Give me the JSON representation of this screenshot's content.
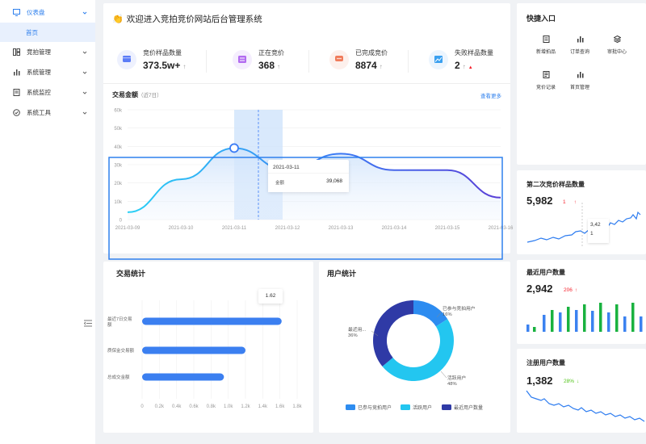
{
  "sidebar": {
    "items": [
      {
        "label": "仪表盘",
        "icon": "monitor-icon",
        "active": true
      },
      {
        "label": "竞拍管理",
        "icon": "layout-icon"
      },
      {
        "label": "系统管理",
        "icon": "bar-chart-icon"
      },
      {
        "label": "系统监控",
        "icon": "document-icon"
      },
      {
        "label": "系统工具",
        "icon": "check-circle-icon"
      }
    ],
    "sub_item": "首页",
    "collapse_icon": "menu-fold-icon"
  },
  "header": {
    "title": "欢迎进入竞拍竞价网站后台管理系统",
    "emoji": "👏"
  },
  "stats": [
    {
      "label": "竞价样品数量",
      "value": "373.5w+",
      "trend": "↑",
      "color": "#5b7cf7",
      "bg": "#eef1fe"
    },
    {
      "label": "正在竞价",
      "value": "368",
      "trend": "↑",
      "color": "#b26bf0",
      "bg": "#f5eefe"
    },
    {
      "label": "已完成竞价",
      "value": "8874",
      "trend": "↑",
      "color": "#f07b5a",
      "bg": "#fdf0ec"
    },
    {
      "label": "失败样品数量",
      "value": "2",
      "trend": "↑",
      "trend2": "▲",
      "color": "#3aa0f0",
      "bg": "#ecf5fe"
    }
  ],
  "trade_amount": {
    "title": "交易金额",
    "subtitle": "（近7日）",
    "more": "查看更多",
    "tooltip": {
      "date": "2021-03-11",
      "label": "金额",
      "value": "39,068"
    }
  },
  "chart_data": [
    {
      "type": "area",
      "title": "交易金额",
      "x": [
        "2021-03-09",
        "2021-03-10",
        "2021-03-11",
        "2021-03-12",
        "2021-03-13",
        "2021-03-14",
        "2021-03-15",
        "2021-03-16"
      ],
      "values": [
        4000,
        22000,
        39068,
        27000,
        36000,
        27000,
        27000,
        12000
      ],
      "yticks": [
        "0",
        "10k",
        "20k",
        "30k",
        "40k",
        "50k",
        "60k"
      ],
      "ylim": [
        0,
        60000
      ]
    },
    {
      "type": "bar",
      "title": "交易统计",
      "categories": [
        "最近7日交易额",
        "质保金交易额",
        "总成交金额"
      ],
      "values": [
        1.62,
        1.2,
        0.95
      ],
      "xticks": [
        "0",
        "0.2k",
        "0.4k",
        "0.6k",
        "0.8k",
        "1.0k",
        "1.2k",
        "1.4k",
        "1.6k",
        "1.8k"
      ],
      "xlim": [
        0,
        1.8
      ],
      "tooltip": "1.62"
    },
    {
      "type": "pie",
      "title": "用户统计",
      "labels": [
        "已参与竞拍用户",
        "活跃用户",
        "最近用户数量"
      ],
      "values": [
        16,
        48,
        36
      ],
      "slice_labels": [
        "已参与竞拍用户\n16%",
        "活跃用户\n48%",
        "最近用...\n36%"
      ],
      "colors": [
        "#2d8cf0",
        "#23c6f0",
        "#2f3aa6"
      ]
    }
  ],
  "trade_stats": {
    "title": "交易统计"
  },
  "user_stats": {
    "title": "用户统计",
    "legend": [
      "已参与竞拍用户",
      "活跃用户",
      "最近用户数量"
    ],
    "slice_labels": [
      [
        "已参与竞拍用户",
        "16%"
      ],
      [
        "活跃用户",
        "48%"
      ],
      [
        "最近用...",
        "36%"
      ]
    ]
  },
  "quick": {
    "title": "快捷入口",
    "items": [
      {
        "label": "新增拍品",
        "icon": "file-icon"
      },
      {
        "label": "订单查询",
        "icon": "bar-chart-icon"
      },
      {
        "label": "审批中心",
        "icon": "layers-icon"
      },
      {
        "label": "竞价记录",
        "icon": "list-file-icon"
      },
      {
        "label": "首页管理",
        "icon": "bar-chart-icon"
      }
    ]
  },
  "small_cards": [
    {
      "title": "第二次竞价样品数量",
      "value": "5,982",
      "badge": "1",
      "arrow": "↑",
      "badge_color": "#f5222d",
      "tooltip": "3,42",
      "tooltip2": "1"
    },
    {
      "title": "最近用户数量",
      "value": "2,942",
      "badge": "206",
      "arrow": "↑",
      "badge_color": "#f5222d"
    },
    {
      "title": "注册用户数量",
      "value": "1,382",
      "badge": "28%",
      "arrow": "↓",
      "badge_color": "#52c41a"
    }
  ]
}
